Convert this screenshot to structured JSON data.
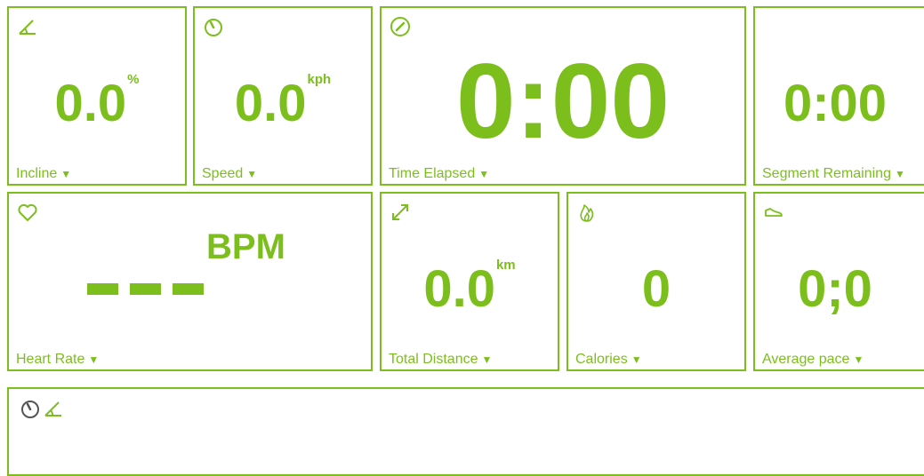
{
  "tiles": {
    "incline": {
      "value": "0.0",
      "unit": "%",
      "label": "Incline"
    },
    "speed": {
      "value": "0.0",
      "unit": "kph",
      "label": "Speed"
    },
    "time_elapsed": {
      "value": "0:00",
      "label": "Time Elapsed"
    },
    "segment_remaining": {
      "value": "0:00",
      "label": "Segment Remaining"
    },
    "heart_rate": {
      "value": "---",
      "unit": "BPM",
      "label": "Heart Rate"
    },
    "total_distance": {
      "value": "0.0",
      "unit": "km",
      "label": "Total Distance"
    },
    "calories": {
      "value": "0",
      "label": "Calories"
    },
    "average_pace": {
      "value": "0;0",
      "label": "Average pace"
    }
  },
  "icons": {
    "incline": "incline-icon",
    "speed": "speedometer-icon",
    "time_elapsed": "stopwatch-icon",
    "heart_rate": "heart-icon",
    "total_distance": "expand-arrow-icon",
    "calories": "flame-icon",
    "average_pace": "shoe-icon",
    "chart": [
      "speedometer-icon",
      "incline-icon"
    ]
  },
  "caret": "▼",
  "colors": {
    "accent": "#7cbf1c",
    "chart_icon": "#555555",
    "background": "#ffffff"
  }
}
